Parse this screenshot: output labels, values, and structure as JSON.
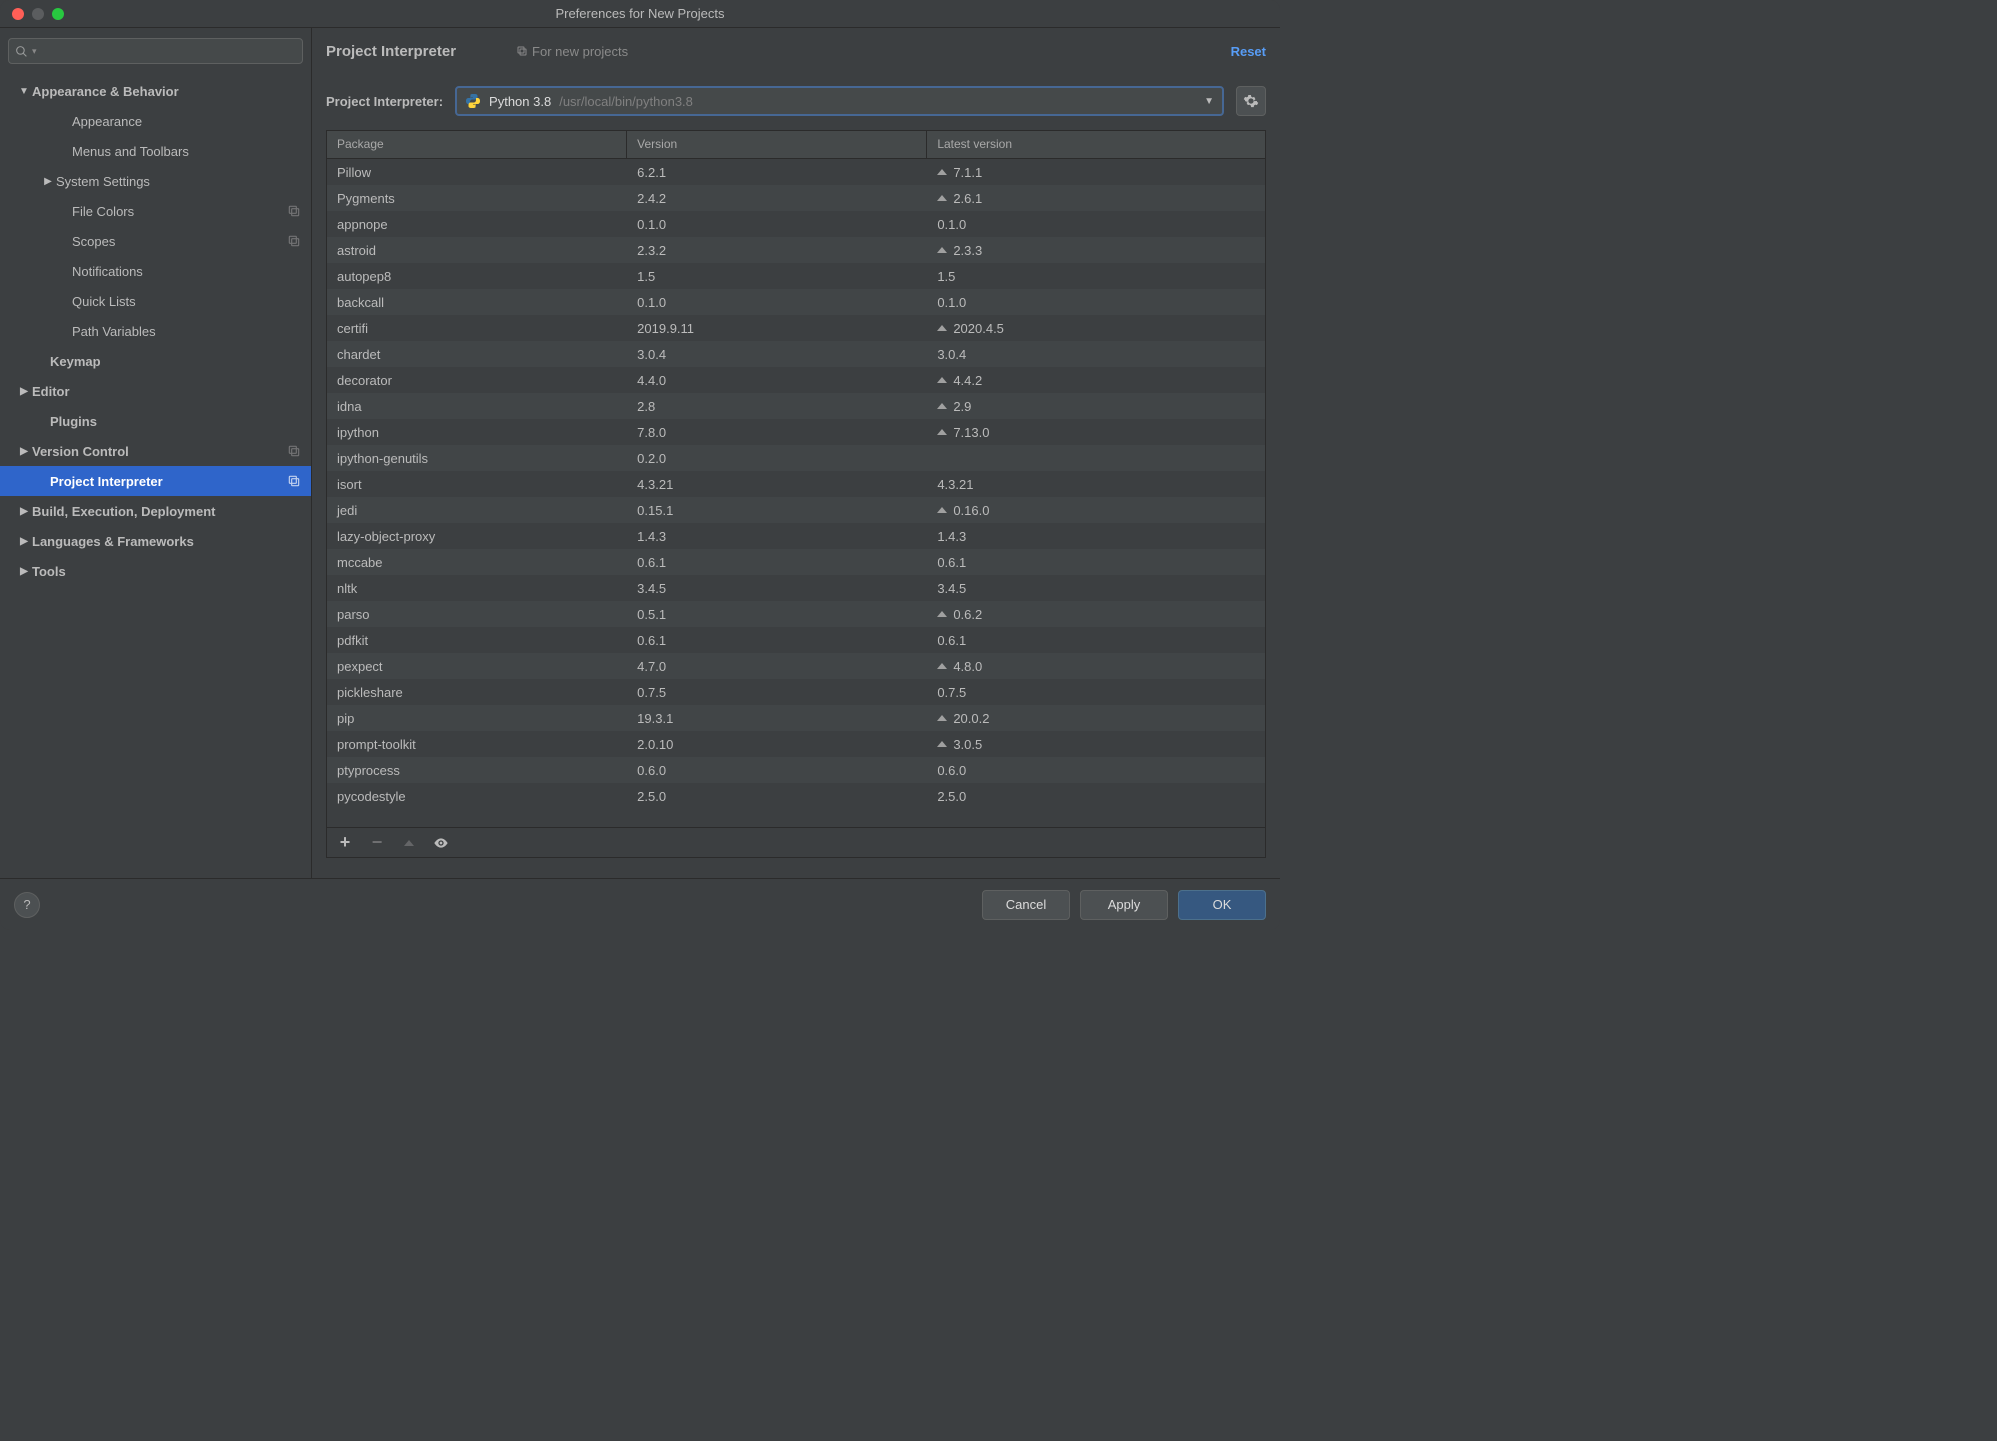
{
  "window": {
    "title": "Preferences for New Projects"
  },
  "sidebar": {
    "search_placeholder": "",
    "items": [
      {
        "label": "Appearance & Behavior",
        "indent": 16,
        "bold": true,
        "arrow": "down",
        "badge": false
      },
      {
        "label": "Appearance",
        "indent": 56,
        "bold": false,
        "arrow": "",
        "badge": false
      },
      {
        "label": "Menus and Toolbars",
        "indent": 56,
        "bold": false,
        "arrow": "",
        "badge": false
      },
      {
        "label": "System Settings",
        "indent": 40,
        "bold": false,
        "arrow": "right",
        "badge": false
      },
      {
        "label": "File Colors",
        "indent": 56,
        "bold": false,
        "arrow": "",
        "badge": true
      },
      {
        "label": "Scopes",
        "indent": 56,
        "bold": false,
        "arrow": "",
        "badge": true
      },
      {
        "label": "Notifications",
        "indent": 56,
        "bold": false,
        "arrow": "",
        "badge": false
      },
      {
        "label": "Quick Lists",
        "indent": 56,
        "bold": false,
        "arrow": "",
        "badge": false
      },
      {
        "label": "Path Variables",
        "indent": 56,
        "bold": false,
        "arrow": "",
        "badge": false
      },
      {
        "label": "Keymap",
        "indent": 34,
        "bold": true,
        "arrow": "",
        "badge": false
      },
      {
        "label": "Editor",
        "indent": 16,
        "bold": true,
        "arrow": "right",
        "badge": false
      },
      {
        "label": "Plugins",
        "indent": 34,
        "bold": true,
        "arrow": "",
        "badge": false
      },
      {
        "label": "Version Control",
        "indent": 16,
        "bold": true,
        "arrow": "right",
        "badge": true
      },
      {
        "label": "Project Interpreter",
        "indent": 34,
        "bold": true,
        "arrow": "",
        "badge": true,
        "selected": true
      },
      {
        "label": "Build, Execution, Deployment",
        "indent": 16,
        "bold": true,
        "arrow": "right",
        "badge": false
      },
      {
        "label": "Languages & Frameworks",
        "indent": 16,
        "bold": true,
        "arrow": "right",
        "badge": false
      },
      {
        "label": "Tools",
        "indent": 16,
        "bold": true,
        "arrow": "right",
        "badge": false
      }
    ]
  },
  "breadcrumb": {
    "title": "Project Interpreter",
    "subtitle": "For new projects",
    "reset": "Reset"
  },
  "interpreter": {
    "label": "Project Interpreter:",
    "name": "Python 3.8",
    "path": "/usr/local/bin/python3.8"
  },
  "table": {
    "headers": {
      "package": "Package",
      "version": "Version",
      "latest": "Latest version"
    },
    "rows": [
      {
        "pkg": "Pillow",
        "ver": "6.2.1",
        "lat": "7.1.1",
        "up": true
      },
      {
        "pkg": "Pygments",
        "ver": "2.4.2",
        "lat": "2.6.1",
        "up": true
      },
      {
        "pkg": "appnope",
        "ver": "0.1.0",
        "lat": "0.1.0",
        "up": false
      },
      {
        "pkg": "astroid",
        "ver": "2.3.2",
        "lat": "2.3.3",
        "up": true
      },
      {
        "pkg": "autopep8",
        "ver": "1.5",
        "lat": "1.5",
        "up": false
      },
      {
        "pkg": "backcall",
        "ver": "0.1.0",
        "lat": "0.1.0",
        "up": false
      },
      {
        "pkg": "certifi",
        "ver": "2019.9.11",
        "lat": "2020.4.5",
        "up": true
      },
      {
        "pkg": "chardet",
        "ver": "3.0.4",
        "lat": "3.0.4",
        "up": false
      },
      {
        "pkg": "decorator",
        "ver": "4.4.0",
        "lat": "4.4.2",
        "up": true
      },
      {
        "pkg": "idna",
        "ver": "2.8",
        "lat": "2.9",
        "up": true
      },
      {
        "pkg": "ipython",
        "ver": "7.8.0",
        "lat": "7.13.0",
        "up": true
      },
      {
        "pkg": "ipython-genutils",
        "ver": "0.2.0",
        "lat": "",
        "up": false
      },
      {
        "pkg": "isort",
        "ver": "4.3.21",
        "lat": "4.3.21",
        "up": false
      },
      {
        "pkg": "jedi",
        "ver": "0.15.1",
        "lat": "0.16.0",
        "up": true
      },
      {
        "pkg": "lazy-object-proxy",
        "ver": "1.4.3",
        "lat": "1.4.3",
        "up": false
      },
      {
        "pkg": "mccabe",
        "ver": "0.6.1",
        "lat": "0.6.1",
        "up": false
      },
      {
        "pkg": "nltk",
        "ver": "3.4.5",
        "lat": "3.4.5",
        "up": false
      },
      {
        "pkg": "parso",
        "ver": "0.5.1",
        "lat": "0.6.2",
        "up": true
      },
      {
        "pkg": "pdfkit",
        "ver": "0.6.1",
        "lat": "0.6.1",
        "up": false
      },
      {
        "pkg": "pexpect",
        "ver": "4.7.0",
        "lat": "4.8.0",
        "up": true
      },
      {
        "pkg": "pickleshare",
        "ver": "0.7.5",
        "lat": "0.7.5",
        "up": false
      },
      {
        "pkg": "pip",
        "ver": "19.3.1",
        "lat": "20.0.2",
        "up": true
      },
      {
        "pkg": "prompt-toolkit",
        "ver": "2.0.10",
        "lat": "3.0.5",
        "up": true
      },
      {
        "pkg": "ptyprocess",
        "ver": "0.6.0",
        "lat": "0.6.0",
        "up": false
      },
      {
        "pkg": "pycodestyle",
        "ver": "2.5.0",
        "lat": "2.5.0",
        "up": false
      }
    ]
  },
  "footer": {
    "cancel": "Cancel",
    "apply": "Apply",
    "ok": "OK"
  }
}
